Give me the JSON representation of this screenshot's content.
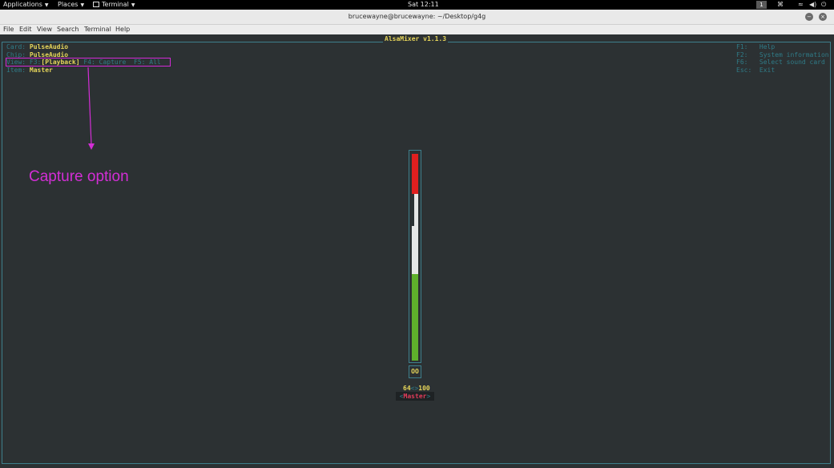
{
  "topbar": {
    "applications": "Applications",
    "places": "Places",
    "terminal": "Terminal",
    "clock": "Sat 12:11",
    "workspace": "1"
  },
  "window": {
    "title": "brucewayne@brucewayne: ~/Desktop/g4g"
  },
  "menu": {
    "items": [
      "File",
      "Edit",
      "View",
      "Search",
      "Terminal",
      "Help"
    ]
  },
  "alsamixer": {
    "title": "AlsaMixer v1.1.3",
    "card_label": "Card:",
    "card_value": "PulseAudio",
    "chip_label": "Chip:",
    "chip_value": "PulseAudio",
    "view_label": "View:",
    "view_f3": "F3:",
    "view_playback": "[Playback]",
    "view_f4": "F4: Capture",
    "view_f5": "F5: All",
    "item_label": "Item:",
    "item_value": "Master",
    "help": [
      {
        "key": "F1:",
        "text": "Help"
      },
      {
        "key": "F2:",
        "text": "System information"
      },
      {
        "key": "F6:",
        "text": "Select sound card"
      },
      {
        "key": "Esc:",
        "text": "Exit"
      }
    ],
    "mute_value": "OO",
    "vol_left": "64",
    "vol_sep": "<>",
    "vol_right": "100",
    "control_name": "Master",
    "levels": {
      "left_percent": 64,
      "right_percent": 100
    }
  },
  "annotation": {
    "text": "Capture option",
    "color": "#d32ed6"
  }
}
